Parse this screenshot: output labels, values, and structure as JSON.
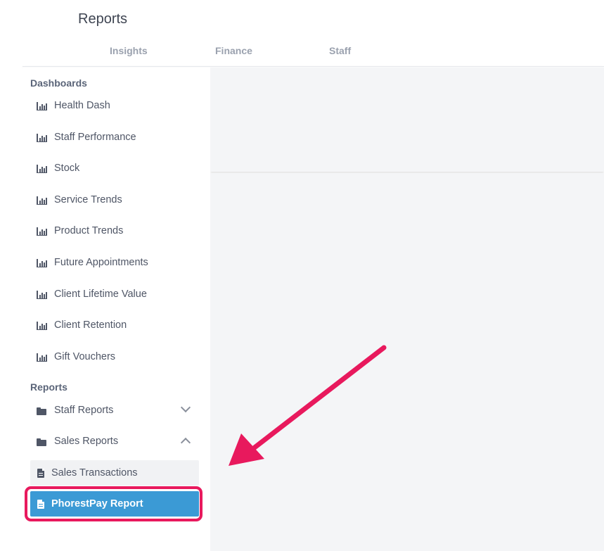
{
  "header": {
    "title": "Reports",
    "tabs": [
      "Insights",
      "Finance",
      "Staff"
    ]
  },
  "sidebar": {
    "dashboards_heading": "Dashboards",
    "dashboards": [
      "Health Dash",
      "Staff Performance",
      "Stock",
      "Service Trends",
      "Product Trends",
      "Future Appointments",
      "Client Lifetime Value",
      "Client Retention",
      "Gift Vouchers"
    ],
    "reports_heading": "Reports",
    "report_folders": [
      {
        "label": "Staff Reports",
        "expanded": false
      },
      {
        "label": "Sales Reports",
        "expanded": true
      }
    ],
    "sales_reports": [
      "Sales Transactions",
      "PhorestPay Report"
    ],
    "active_item": "PhorestPay Report"
  },
  "colors": {
    "accent": "#3b9ad5",
    "annotation": "#e8195d",
    "content_bg": "#f4f5f7"
  }
}
